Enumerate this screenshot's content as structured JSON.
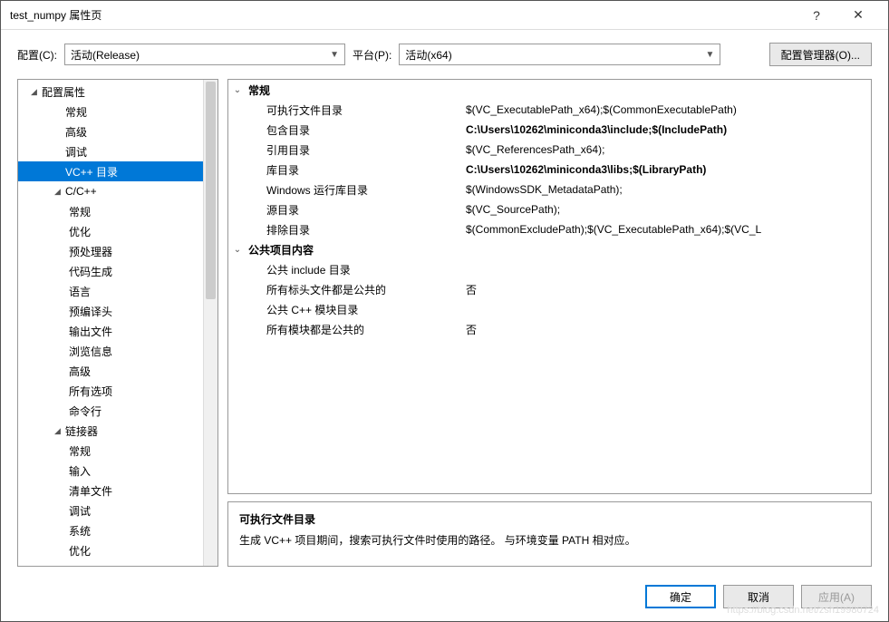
{
  "window": {
    "title": "test_numpy 属性页"
  },
  "toolbar": {
    "config_label": "配置(C):",
    "config_value": "活动(Release)",
    "platform_label": "平台(P):",
    "platform_value": "活动(x64)",
    "manager_label": "配置管理器(O)..."
  },
  "tree": [
    {
      "label": "配置属性",
      "depth": 1,
      "caret": "▲"
    },
    {
      "label": "常规",
      "depth": 2
    },
    {
      "label": "高级",
      "depth": 2
    },
    {
      "label": "调试",
      "depth": 2
    },
    {
      "label": "VC++ 目录",
      "depth": 2,
      "selected": true
    },
    {
      "label": "C/C++",
      "depth": 2,
      "caret": "▲"
    },
    {
      "label": "常规",
      "depth": 3
    },
    {
      "label": "优化",
      "depth": 3
    },
    {
      "label": "预处理器",
      "depth": 3
    },
    {
      "label": "代码生成",
      "depth": 3
    },
    {
      "label": "语言",
      "depth": 3
    },
    {
      "label": "预编译头",
      "depth": 3
    },
    {
      "label": "输出文件",
      "depth": 3
    },
    {
      "label": "浏览信息",
      "depth": 3
    },
    {
      "label": "高级",
      "depth": 3
    },
    {
      "label": "所有选项",
      "depth": 3
    },
    {
      "label": "命令行",
      "depth": 3
    },
    {
      "label": "链接器",
      "depth": 2,
      "caret": "▲"
    },
    {
      "label": "常规",
      "depth": 3
    },
    {
      "label": "输入",
      "depth": 3
    },
    {
      "label": "清单文件",
      "depth": 3
    },
    {
      "label": "调试",
      "depth": 3
    },
    {
      "label": "系统",
      "depth": 3
    },
    {
      "label": "优化",
      "depth": 3
    }
  ],
  "grid": [
    {
      "section": true,
      "name": "常规",
      "value": ""
    },
    {
      "name": "可执行文件目录",
      "value": "$(VC_ExecutablePath_x64);$(CommonExecutablePath)"
    },
    {
      "name": "包含目录",
      "value": "C:\\Users\\10262\\miniconda3\\include;$(IncludePath)",
      "bold": true
    },
    {
      "name": "引用目录",
      "value": "$(VC_ReferencesPath_x64);"
    },
    {
      "name": "库目录",
      "value": "C:\\Users\\10262\\miniconda3\\libs;$(LibraryPath)",
      "bold": true
    },
    {
      "name": "Windows 运行库目录",
      "value": "$(WindowsSDK_MetadataPath);"
    },
    {
      "name": "源目录",
      "value": "$(VC_SourcePath);"
    },
    {
      "name": "排除目录",
      "value": "$(CommonExcludePath);$(VC_ExecutablePath_x64);$(VC_L"
    },
    {
      "section": true,
      "name": "公共项目内容",
      "value": ""
    },
    {
      "name": "公共 include 目录",
      "value": ""
    },
    {
      "name": "所有标头文件都是公共的",
      "value": "否"
    },
    {
      "name": "公共 C++ 模块目录",
      "value": ""
    },
    {
      "name": "所有模块都是公共的",
      "value": "否"
    }
  ],
  "help": {
    "title": "可执行文件目录",
    "text": "生成 VC++ 项目期间，搜索可执行文件时使用的路径。   与环境变量 PATH 相对应。"
  },
  "footer": {
    "ok": "确定",
    "cancel": "取消",
    "apply": "应用(A)"
  },
  "watermark": "https://blog.csdn.net/zsh19980724"
}
